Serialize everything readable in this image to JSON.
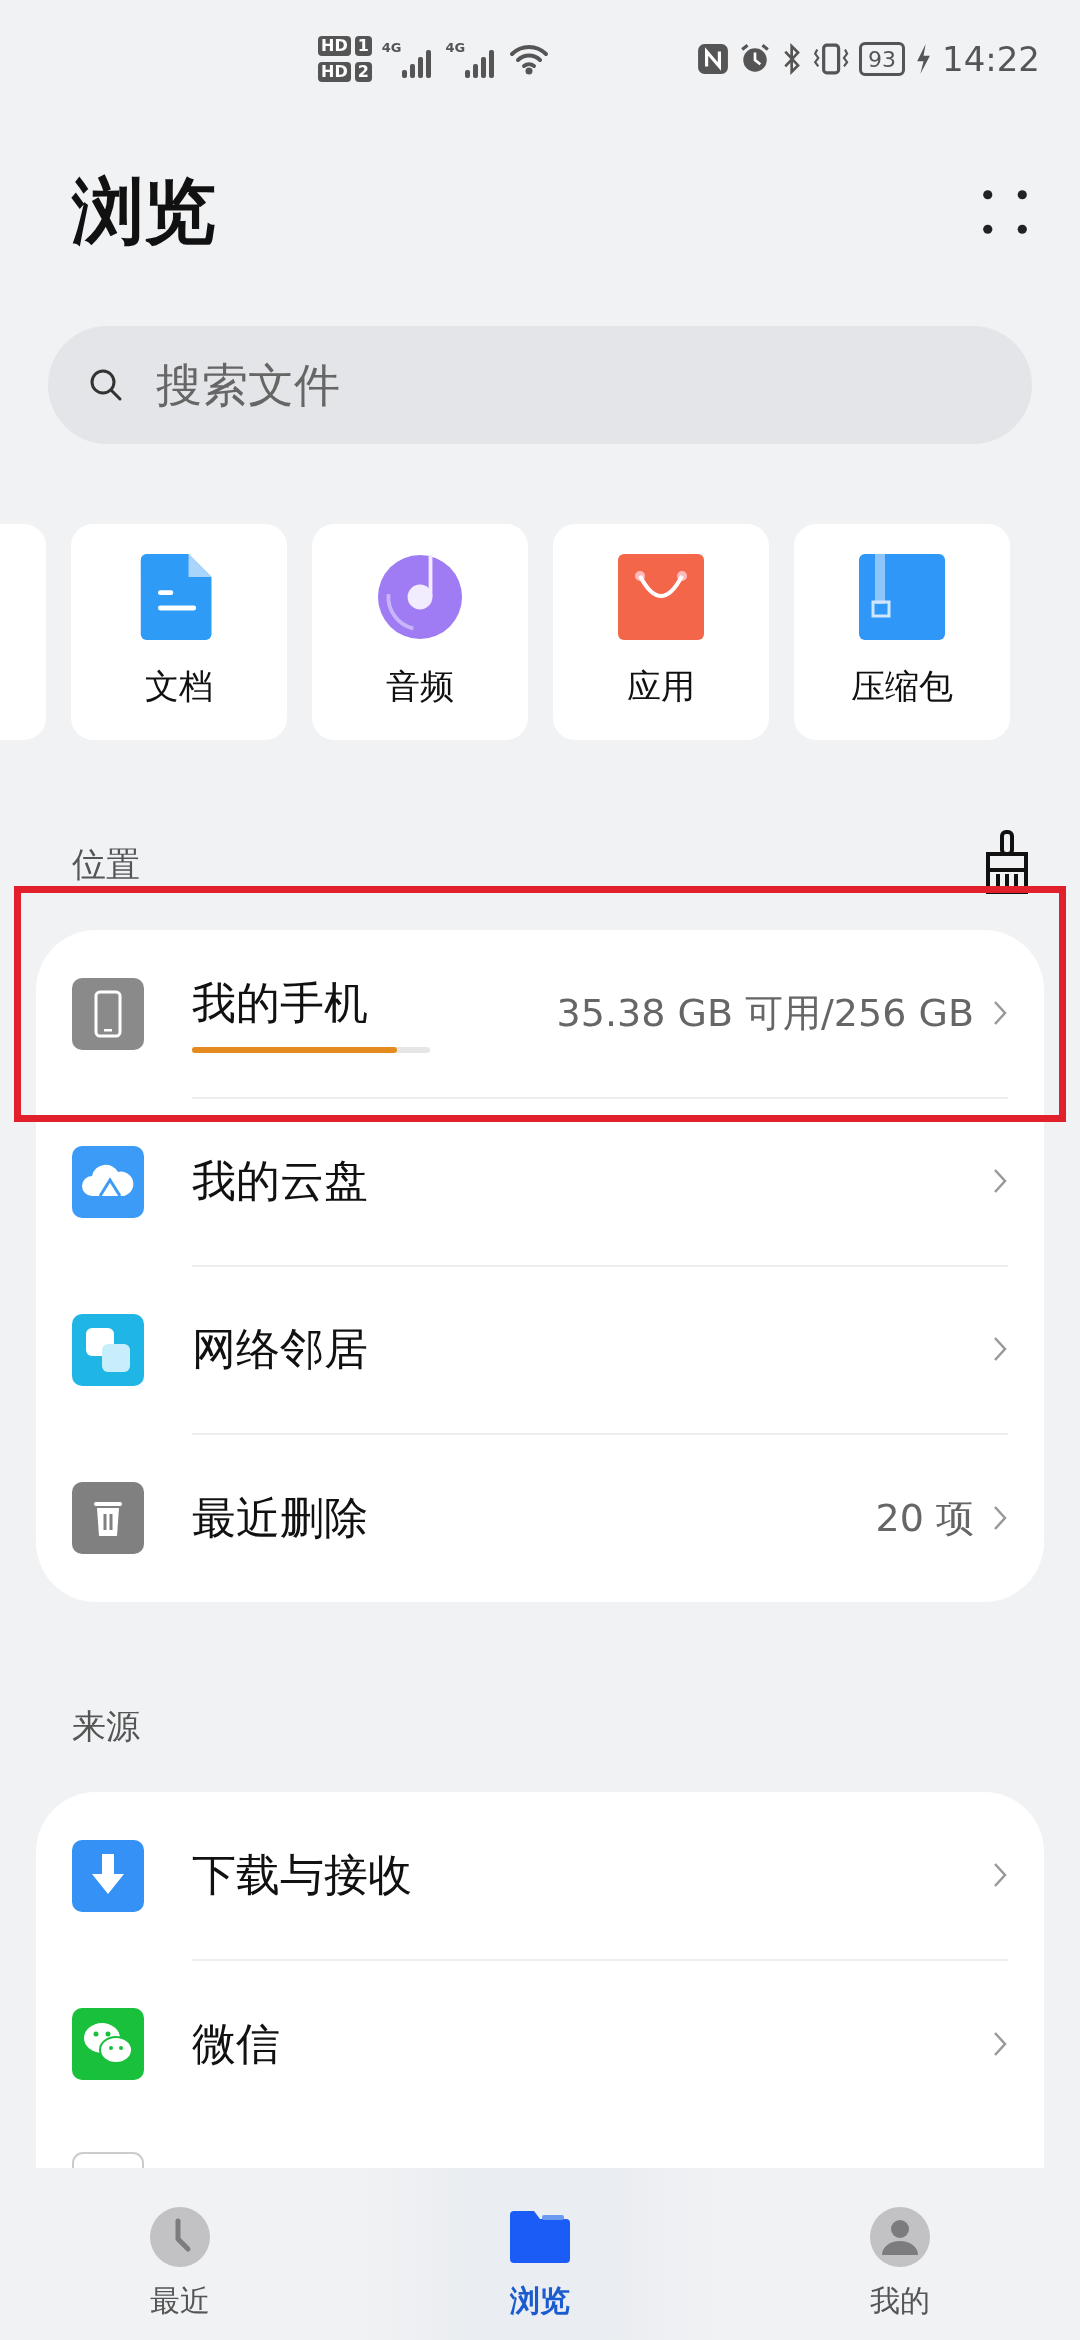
{
  "status_bar": {
    "sims": [
      {
        "badge": "HD",
        "slot": "1"
      },
      {
        "badge": "HD",
        "slot": "2"
      }
    ],
    "networks": [
      "4G",
      "4G"
    ],
    "battery": "93",
    "time": "14:22"
  },
  "title": "浏览",
  "search": {
    "placeholder": "搜索文件"
  },
  "categories": [
    {
      "kind": "partial"
    },
    {
      "kind": "document",
      "label": "文档"
    },
    {
      "kind": "audio",
      "label": "音频"
    },
    {
      "kind": "app",
      "label": "应用"
    },
    {
      "kind": "archive",
      "label": "压缩包"
    }
  ],
  "sections": [
    {
      "title": "位置",
      "rows": [
        {
          "kind": "phone",
          "label": "我的手机",
          "detail": "35.38 GB 可用/256 GB",
          "level": 0.86,
          "highlighted": true
        },
        {
          "kind": "cloud",
          "label": "我的云盘"
        },
        {
          "kind": "network",
          "label": "网络邻居"
        },
        {
          "kind": "trash",
          "label": "最近删除",
          "detail": "20 项"
        }
      ]
    },
    {
      "title": "来源",
      "rows": [
        {
          "kind": "download",
          "label": "下载与接收"
        },
        {
          "kind": "wechat",
          "label": "微信"
        },
        {
          "kind": "partial"
        }
      ]
    }
  ],
  "tabs": [
    {
      "kind": "recent",
      "label": "最近",
      "selected": false
    },
    {
      "kind": "browse",
      "label": "浏览",
      "selected": true
    },
    {
      "kind": "mine",
      "label": "我的",
      "selected": false
    }
  ]
}
